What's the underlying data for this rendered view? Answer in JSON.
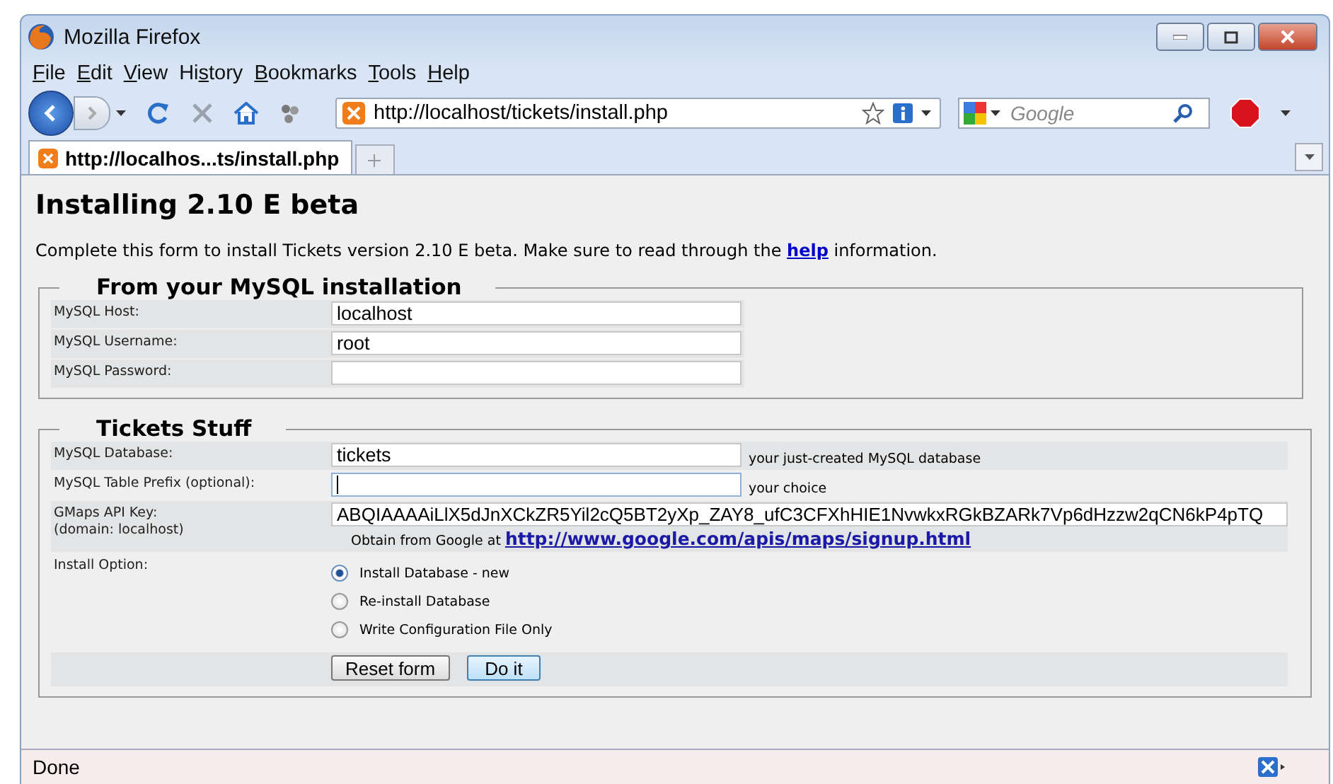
{
  "window": {
    "title": "Mozilla Firefox"
  },
  "menu": [
    {
      "key": "F",
      "post": "ile"
    },
    {
      "key": "E",
      "post": "dit"
    },
    {
      "key": "V",
      "post": "iew"
    },
    {
      "pre": "Hi",
      "key": "s",
      "post": "tory"
    },
    {
      "key": "B",
      "post": "ookmarks"
    },
    {
      "key": "T",
      "post": "ools"
    },
    {
      "key": "H",
      "post": "elp"
    }
  ],
  "address": {
    "value": "http://localhost/tickets/install.php"
  },
  "search": {
    "placeholder": "Google"
  },
  "tabs": [
    {
      "label": "http://localhos...ts/install.php",
      "selected": true
    }
  ],
  "page": {
    "heading": "Installing 2.10 E beta",
    "intro": {
      "before": "Complete this form to install Tickets version 2.10 E beta. Make sure to read through the",
      "link": "help",
      "after": "information."
    },
    "sections": [
      {
        "legend": "From your MySQL installation",
        "rows": [
          {
            "kind": "text",
            "label": [
              "MySQL Host:"
            ],
            "value": "localhost",
            "focused": false
          },
          {
            "kind": "text",
            "label": [
              "MySQL Username:"
            ],
            "value": "root",
            "focused": false
          },
          {
            "kind": "text",
            "label": [
              "MySQL Password:"
            ],
            "value": "",
            "focused": false
          }
        ]
      },
      {
        "legend": "Tickets Stuff",
        "rows": [
          {
            "kind": "text",
            "label": [
              "MySQL Database:"
            ],
            "value": "tickets",
            "hint": "your just-created MySQL database",
            "focused": false
          },
          {
            "kind": "text",
            "label": [
              "MySQL Table Prefix (optional):"
            ],
            "value": "",
            "hint": "your choice",
            "focused": true
          },
          {
            "kind": "wide",
            "label": [
              "GMaps API Key:",
              "(domain: localhost)"
            ],
            "value": "ABQIAAAAiLlX5dJnXCkZR5Yil2cQ5BT2yXp_ZAY8_ufC3CFXhHIE1NvwkxRGkBZARk7Vp6dHzzw2qCN6kP4pTQ",
            "note": "Obtain from Google at",
            "note_link": "http://www.google.com/apis/maps/signup.html",
            "focused": false
          },
          {
            "kind": "radio",
            "label": [
              "Install Option:"
            ],
            "options": [
              {
                "label": "Install Database - new",
                "selected": true
              },
              {
                "label": "Re-install Database",
                "selected": false
              },
              {
                "label": "Write Configuration File Only",
                "selected": false
              }
            ]
          }
        ],
        "buttons": [
          {
            "label": "Reset form",
            "default": false
          },
          {
            "label": "Do it",
            "default": true
          }
        ]
      }
    ]
  },
  "status_bar": {
    "text": "Done"
  }
}
